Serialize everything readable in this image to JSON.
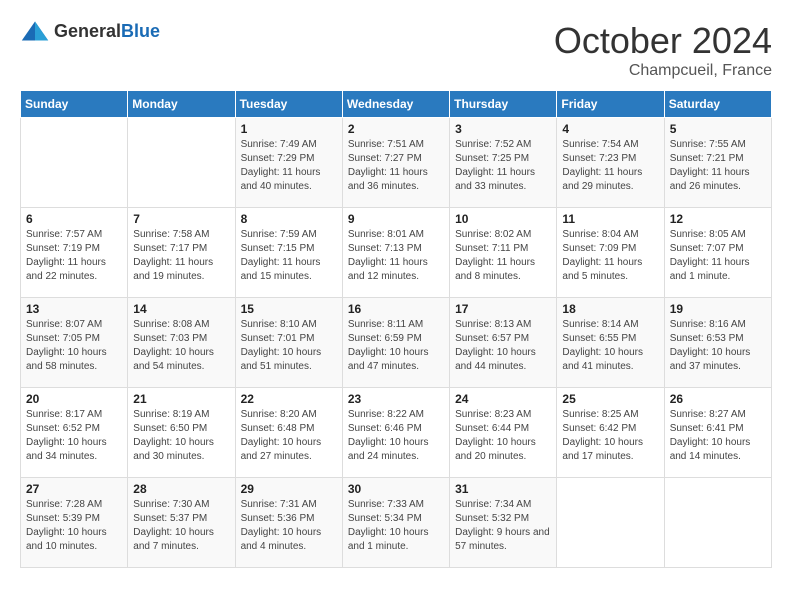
{
  "logo": {
    "general": "General",
    "blue": "Blue"
  },
  "title": "October 2024",
  "subtitle": "Champcueil, France",
  "days_header": [
    "Sunday",
    "Monday",
    "Tuesday",
    "Wednesday",
    "Thursday",
    "Friday",
    "Saturday"
  ],
  "weeks": [
    [
      {
        "day": "",
        "info": ""
      },
      {
        "day": "",
        "info": ""
      },
      {
        "day": "1",
        "info": "Sunrise: 7:49 AM\nSunset: 7:29 PM\nDaylight: 11 hours and 40 minutes."
      },
      {
        "day": "2",
        "info": "Sunrise: 7:51 AM\nSunset: 7:27 PM\nDaylight: 11 hours and 36 minutes."
      },
      {
        "day": "3",
        "info": "Sunrise: 7:52 AM\nSunset: 7:25 PM\nDaylight: 11 hours and 33 minutes."
      },
      {
        "day": "4",
        "info": "Sunrise: 7:54 AM\nSunset: 7:23 PM\nDaylight: 11 hours and 29 minutes."
      },
      {
        "day": "5",
        "info": "Sunrise: 7:55 AM\nSunset: 7:21 PM\nDaylight: 11 hours and 26 minutes."
      }
    ],
    [
      {
        "day": "6",
        "info": "Sunrise: 7:57 AM\nSunset: 7:19 PM\nDaylight: 11 hours and 22 minutes."
      },
      {
        "day": "7",
        "info": "Sunrise: 7:58 AM\nSunset: 7:17 PM\nDaylight: 11 hours and 19 minutes."
      },
      {
        "day": "8",
        "info": "Sunrise: 7:59 AM\nSunset: 7:15 PM\nDaylight: 11 hours and 15 minutes."
      },
      {
        "day": "9",
        "info": "Sunrise: 8:01 AM\nSunset: 7:13 PM\nDaylight: 11 hours and 12 minutes."
      },
      {
        "day": "10",
        "info": "Sunrise: 8:02 AM\nSunset: 7:11 PM\nDaylight: 11 hours and 8 minutes."
      },
      {
        "day": "11",
        "info": "Sunrise: 8:04 AM\nSunset: 7:09 PM\nDaylight: 11 hours and 5 minutes."
      },
      {
        "day": "12",
        "info": "Sunrise: 8:05 AM\nSunset: 7:07 PM\nDaylight: 11 hours and 1 minute."
      }
    ],
    [
      {
        "day": "13",
        "info": "Sunrise: 8:07 AM\nSunset: 7:05 PM\nDaylight: 10 hours and 58 minutes."
      },
      {
        "day": "14",
        "info": "Sunrise: 8:08 AM\nSunset: 7:03 PM\nDaylight: 10 hours and 54 minutes."
      },
      {
        "day": "15",
        "info": "Sunrise: 8:10 AM\nSunset: 7:01 PM\nDaylight: 10 hours and 51 minutes."
      },
      {
        "day": "16",
        "info": "Sunrise: 8:11 AM\nSunset: 6:59 PM\nDaylight: 10 hours and 47 minutes."
      },
      {
        "day": "17",
        "info": "Sunrise: 8:13 AM\nSunset: 6:57 PM\nDaylight: 10 hours and 44 minutes."
      },
      {
        "day": "18",
        "info": "Sunrise: 8:14 AM\nSunset: 6:55 PM\nDaylight: 10 hours and 41 minutes."
      },
      {
        "day": "19",
        "info": "Sunrise: 8:16 AM\nSunset: 6:53 PM\nDaylight: 10 hours and 37 minutes."
      }
    ],
    [
      {
        "day": "20",
        "info": "Sunrise: 8:17 AM\nSunset: 6:52 PM\nDaylight: 10 hours and 34 minutes."
      },
      {
        "day": "21",
        "info": "Sunrise: 8:19 AM\nSunset: 6:50 PM\nDaylight: 10 hours and 30 minutes."
      },
      {
        "day": "22",
        "info": "Sunrise: 8:20 AM\nSunset: 6:48 PM\nDaylight: 10 hours and 27 minutes."
      },
      {
        "day": "23",
        "info": "Sunrise: 8:22 AM\nSunset: 6:46 PM\nDaylight: 10 hours and 24 minutes."
      },
      {
        "day": "24",
        "info": "Sunrise: 8:23 AM\nSunset: 6:44 PM\nDaylight: 10 hours and 20 minutes."
      },
      {
        "day": "25",
        "info": "Sunrise: 8:25 AM\nSunset: 6:42 PM\nDaylight: 10 hours and 17 minutes."
      },
      {
        "day": "26",
        "info": "Sunrise: 8:27 AM\nSunset: 6:41 PM\nDaylight: 10 hours and 14 minutes."
      }
    ],
    [
      {
        "day": "27",
        "info": "Sunrise: 7:28 AM\nSunset: 5:39 PM\nDaylight: 10 hours and 10 minutes."
      },
      {
        "day": "28",
        "info": "Sunrise: 7:30 AM\nSunset: 5:37 PM\nDaylight: 10 hours and 7 minutes."
      },
      {
        "day": "29",
        "info": "Sunrise: 7:31 AM\nSunset: 5:36 PM\nDaylight: 10 hours and 4 minutes."
      },
      {
        "day": "30",
        "info": "Sunrise: 7:33 AM\nSunset: 5:34 PM\nDaylight: 10 hours and 1 minute."
      },
      {
        "day": "31",
        "info": "Sunrise: 7:34 AM\nSunset: 5:32 PM\nDaylight: 9 hours and 57 minutes."
      },
      {
        "day": "",
        "info": ""
      },
      {
        "day": "",
        "info": ""
      }
    ]
  ]
}
